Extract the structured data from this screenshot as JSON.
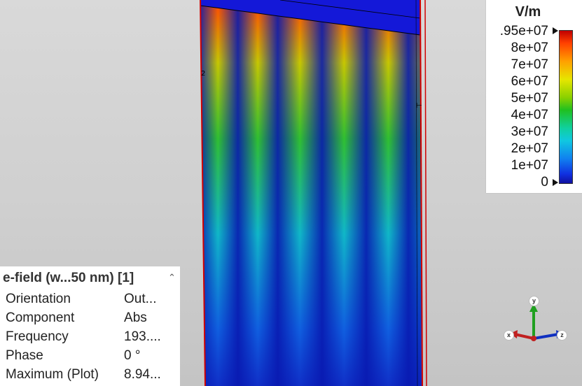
{
  "legend": {
    "unit": "V/m",
    "ticks": [
      ".95e+07",
      "8e+07",
      "7e+07",
      "6e+07",
      "5e+07",
      "4e+07",
      "3e+07",
      "2e+07",
      "1e+07",
      "0"
    ],
    "colors": [
      "#c00000",
      "#ff4000",
      "#ffa000",
      "#e6e600",
      "#88d000",
      "#20c020",
      "#10d0a0",
      "#10c8e0",
      "#1080f0",
      "#1030e0",
      "#1010a0"
    ]
  },
  "markers": {
    "port_label": "2"
  },
  "info": {
    "title": "e-field (w...50 nm) [1]",
    "rows": [
      {
        "label": "Orientation",
        "value": "Out..."
      },
      {
        "label": "Component",
        "value": "Abs"
      },
      {
        "label": "Frequency",
        "value": "193...."
      },
      {
        "label": "Phase",
        "value": "0 °"
      },
      {
        "label": "Maximum (Plot)",
        "value": "8.94..."
      }
    ]
  },
  "axes": {
    "x": "x",
    "y": "y",
    "z": "z"
  }
}
